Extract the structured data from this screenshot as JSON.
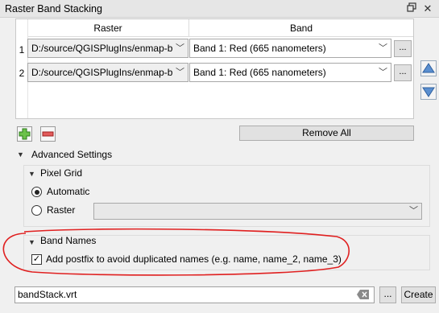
{
  "window": {
    "title": "Raster Band Stacking",
    "float_icon": "float-icon",
    "close_icon": "close-icon"
  },
  "table": {
    "headers": [
      "Raster",
      "Band"
    ],
    "rows": [
      {
        "number": "1",
        "raster": "D:/source/QGISPlugIns/enmap-b",
        "band": "Band 1: Red (665 nanometers)",
        "browse": "..."
      },
      {
        "number": "2",
        "raster": "D:/source/QGISPlugIns/enmap-b",
        "band": "Band 1: Red (665 nanometers)",
        "browse": "..."
      }
    ]
  },
  "actions": {
    "add_icon": "plus-icon",
    "remove_icon": "minus-icon",
    "remove_all_label": "Remove All",
    "move_up_icon": "arrow-up-icon",
    "move_down_icon": "arrow-down-icon"
  },
  "advanced": {
    "label": "Advanced Settings",
    "pixel_grid": {
      "label": "Pixel Grid",
      "options": [
        {
          "label": "Automatic",
          "selected": true
        },
        {
          "label": "Raster",
          "selected": false
        }
      ],
      "raster_value": ""
    },
    "band_names": {
      "label": "Band Names",
      "checkbox_label": "Add postfix to avoid duplicated names (e.g. name, name_2, name_3)",
      "checked": true
    }
  },
  "output": {
    "filename": "bandStack.vrt",
    "browse_label": "...",
    "create_label": "Create"
  },
  "annotation": {
    "color": "#e02020"
  }
}
